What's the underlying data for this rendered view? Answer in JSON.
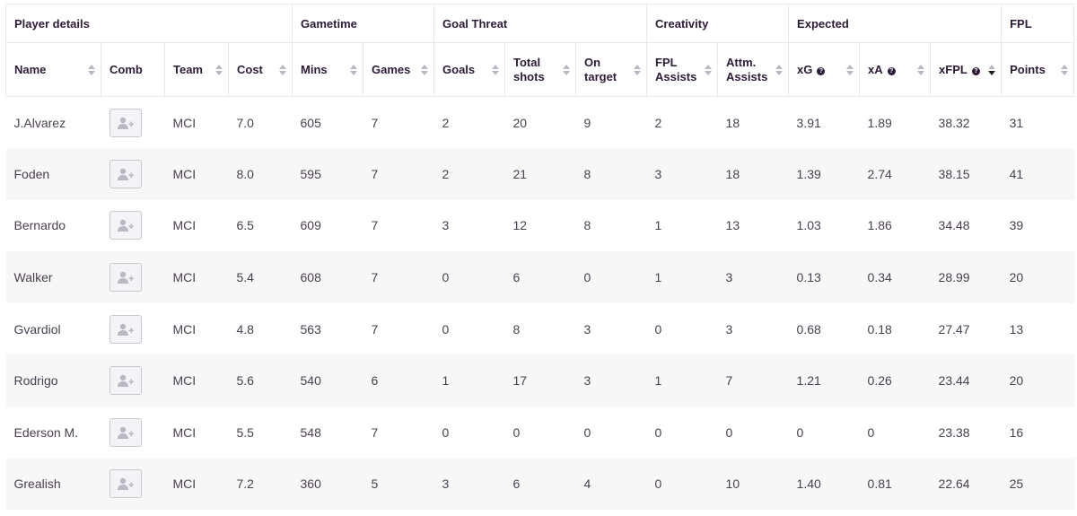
{
  "groups": [
    {
      "label": "Player details",
      "span": 4
    },
    {
      "label": "Gametime",
      "span": 2
    },
    {
      "label": "Goal Threat",
      "span": 3
    },
    {
      "label": "Creativity",
      "span": 2
    },
    {
      "label": "Expected",
      "span": 3
    },
    {
      "label": "FPL",
      "span": 1
    }
  ],
  "columns": [
    {
      "label": "Name",
      "sortable": true
    },
    {
      "label": "Comb",
      "sortable": false
    },
    {
      "label": "Team",
      "sortable": true
    },
    {
      "label": "Cost",
      "sortable": true
    },
    {
      "label": "Mins",
      "sortable": true
    },
    {
      "label": "Games",
      "sortable": true
    },
    {
      "label": "Goals",
      "sortable": true
    },
    {
      "label": "Total\nshots",
      "sortable": true
    },
    {
      "label": "On\ntarget",
      "sortable": true
    },
    {
      "label": "FPL\nAssists",
      "sortable": true
    },
    {
      "label": "Attm.\nAssists",
      "sortable": true
    },
    {
      "label": "xG",
      "sortable": true,
      "help": true
    },
    {
      "label": "xA",
      "sortable": true,
      "help": true
    },
    {
      "label": "xFPL",
      "sortable": true,
      "help": true,
      "active": true
    },
    {
      "label": "Points",
      "sortable": true
    }
  ],
  "rows": [
    {
      "name": "J.Alvarez",
      "team": "MCI",
      "cost": "7.0",
      "mins": "605",
      "games": "7",
      "goals": "2",
      "shots": "20",
      "on_target": "9",
      "fpl_assists": "2",
      "attm_assists": "18",
      "xg": "3.91",
      "xa": "1.89",
      "xfpl": "38.32",
      "points": "31"
    },
    {
      "name": "Foden",
      "team": "MCI",
      "cost": "8.0",
      "mins": "595",
      "games": "7",
      "goals": "2",
      "shots": "21",
      "on_target": "8",
      "fpl_assists": "3",
      "attm_assists": "18",
      "xg": "1.39",
      "xa": "2.74",
      "xfpl": "38.15",
      "points": "41"
    },
    {
      "name": "Bernardo",
      "team": "MCI",
      "cost": "6.5",
      "mins": "609",
      "games": "7",
      "goals": "3",
      "shots": "12",
      "on_target": "8",
      "fpl_assists": "1",
      "attm_assists": "13",
      "xg": "1.03",
      "xa": "1.86",
      "xfpl": "34.48",
      "points": "39"
    },
    {
      "name": "Walker",
      "team": "MCI",
      "cost": "5.4",
      "mins": "608",
      "games": "7",
      "goals": "0",
      "shots": "6",
      "on_target": "0",
      "fpl_assists": "1",
      "attm_assists": "3",
      "xg": "0.13",
      "xa": "0.34",
      "xfpl": "28.99",
      "points": "20"
    },
    {
      "name": "Gvardiol",
      "team": "MCI",
      "cost": "4.8",
      "mins": "563",
      "games": "7",
      "goals": "0",
      "shots": "8",
      "on_target": "3",
      "fpl_assists": "0",
      "attm_assists": "3",
      "xg": "0.68",
      "xa": "0.18",
      "xfpl": "27.47",
      "points": "13"
    },
    {
      "name": "Rodrigo",
      "team": "MCI",
      "cost": "5.6",
      "mins": "540",
      "games": "6",
      "goals": "1",
      "shots": "17",
      "on_target": "3",
      "fpl_assists": "1",
      "attm_assists": "7",
      "xg": "1.21",
      "xa": "0.26",
      "xfpl": "23.44",
      "points": "20"
    },
    {
      "name": "Ederson M.",
      "team": "MCI",
      "cost": "5.5",
      "mins": "548",
      "games": "7",
      "goals": "0",
      "shots": "0",
      "on_target": "0",
      "fpl_assists": "0",
      "attm_assists": "0",
      "xg": "0",
      "xa": "0",
      "xfpl": "23.38",
      "points": "16"
    },
    {
      "name": "Grealish",
      "team": "MCI",
      "cost": "7.2",
      "mins": "360",
      "games": "5",
      "goals": "3",
      "shots": "6",
      "on_target": "4",
      "fpl_assists": "0",
      "attm_assists": "10",
      "xg": "1.40",
      "xa": "0.81",
      "xfpl": "22.64",
      "points": "25"
    }
  ],
  "icons": {
    "add": "user-plus-icon",
    "help": "question-circle-icon"
  },
  "colors": {
    "header_text": "#2d1b38",
    "stripe": "#f7f7f8",
    "border": "#e8e8ee"
  }
}
